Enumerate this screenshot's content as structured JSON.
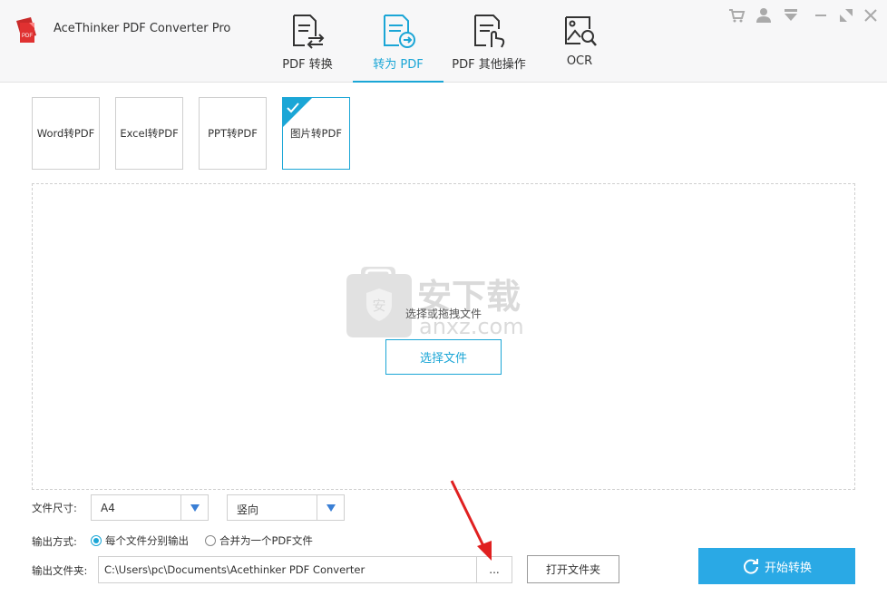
{
  "app": {
    "title": "AceThinker PDF Converter Pro",
    "logo_text": "PDF"
  },
  "nav": {
    "tabs": [
      {
        "label": "PDF 转换",
        "icon": "pdf-convert-icon"
      },
      {
        "label": "转为 PDF",
        "icon": "to-pdf-icon",
        "active": true
      },
      {
        "label": "PDF 其他操作",
        "icon": "pdf-other-ops-icon"
      },
      {
        "label": "OCR",
        "icon": "ocr-icon"
      }
    ]
  },
  "window_controls": [
    "cart-icon",
    "user-icon",
    "dropdown-menu-icon",
    "minimize-icon",
    "restore-icon",
    "close-icon"
  ],
  "subtabs": [
    {
      "label": "Word转PDF"
    },
    {
      "label": "Excel转PDF"
    },
    {
      "label": "PPT转PDF"
    },
    {
      "label": "图片转PDF",
      "active": true
    }
  ],
  "dropzone": {
    "hint": "选择或拖拽文件",
    "choose_button": "选择文件",
    "watermark_text": "安下载",
    "watermark_sub": "anxz.com",
    "watermark_badge": "安"
  },
  "options": {
    "size_label": "文件尺寸:",
    "size_value": "A4",
    "orientation_value": "竖向",
    "output_mode_label": "输出方式:",
    "mode_separate": "每个文件分别输出",
    "mode_merge": "合并为一个PDF文件",
    "mode_selected": "separate",
    "folder_label": "输出文件夹:",
    "folder_path": "C:\\Users\\pc\\Documents\\Acethinker PDF Converter",
    "browse_label": "...",
    "open_folder_button": "打开文件夹",
    "start_button": "开始转换"
  },
  "colors": {
    "accent": "#1ba6d6",
    "start_button": "#2aa9e5",
    "annotation_arrow": "#e02020"
  }
}
